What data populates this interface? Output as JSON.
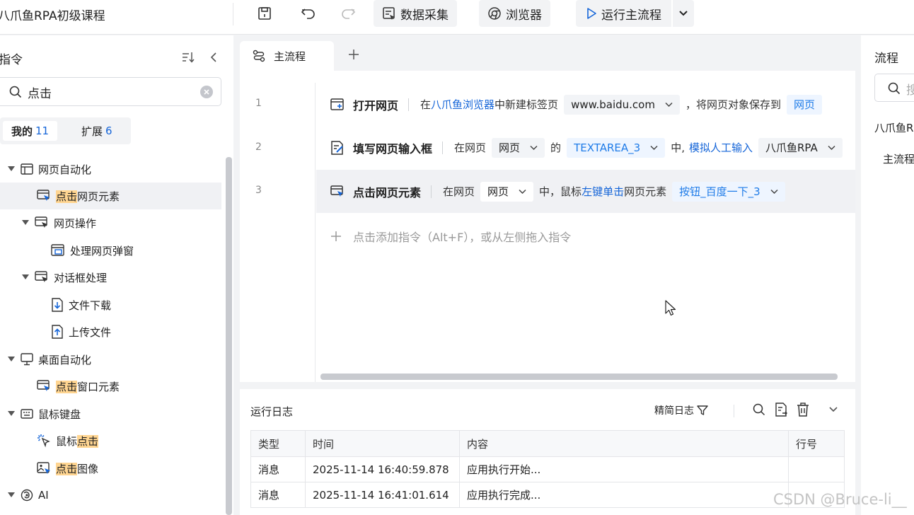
{
  "app": {
    "title": "八爪鱼RPA初级课程"
  },
  "toolbar": {
    "data_collect_label": "数据采集",
    "browser_label": "浏览器",
    "run_label": "运行主流程"
  },
  "commands_panel": {
    "title": "指令",
    "search": {
      "value": "点击"
    },
    "tabs": [
      {
        "label": "我的",
        "count": "11"
      },
      {
        "label": "扩展",
        "count": "6"
      }
    ],
    "tree": {
      "web_automation": "网页自动化",
      "click_web_element_hl": "点击",
      "click_web_element_rest": "网页元素",
      "web_operation": "网页操作",
      "handle_popup": "处理网页弹窗",
      "dialog_handling": "对话框处理",
      "file_download": "文件下载",
      "upload_file": "上传文件",
      "desktop_automation": "桌面自动化",
      "click_window_element_hl": "点击",
      "click_window_element_rest": "窗口元素",
      "mouse_keyboard": "鼠标键盘",
      "mouse_click_pre": "鼠标",
      "mouse_click_hl": "点击",
      "click_image_hl": "点击",
      "click_image_rest": "图像",
      "ai": "AI"
    }
  },
  "flow": {
    "tab_label": "主流程",
    "rows": [
      {
        "no": "1",
        "name": "打开网页",
        "t1": "在",
        "link1": "八爪鱼浏览器",
        "t2": "中新建标签页",
        "chip1": "www.baidu.com",
        "t3": "，将网页对象保存到",
        "chip2": "网页"
      },
      {
        "no": "2",
        "name": "填写网页输入框",
        "t1": "在网页",
        "chip1": "网页",
        "t2": "的",
        "chip2": "TEXTAREA_3",
        "t3": "中,",
        "link1": "模拟人工输入",
        "chip3": "八爪鱼RPA"
      },
      {
        "no": "3",
        "name": "点击网页元素",
        "t1": "在网页",
        "chip1": "网页",
        "t2": "中，鼠标",
        "link1": "左键单击",
        "t3": "网页元素",
        "chip2": "按钮_百度一下_3"
      }
    ],
    "add_hint": "点击添加指令（Alt+F），或从左侧拖入指令"
  },
  "log": {
    "title": "运行日志",
    "filter_label": "精简日志",
    "columns": [
      "类型",
      "时间",
      "内容",
      "行号"
    ],
    "rows": [
      {
        "type": "消息",
        "time": "2025-11-14 16:40:59.878",
        "content": "应用执行开始...",
        "line": ""
      },
      {
        "type": "消息",
        "time": "2025-11-14 16:41:01.614",
        "content": "应用执行完成...",
        "line": ""
      }
    ]
  },
  "right_panel": {
    "title": "流程",
    "search_placeholder": "搜",
    "project": "八爪鱼R",
    "flow_item": "主流程"
  },
  "watermark": "CSDN @Bruce-li__",
  "colors": {
    "accent": "#1565d8",
    "highlight": "#ffd591"
  }
}
